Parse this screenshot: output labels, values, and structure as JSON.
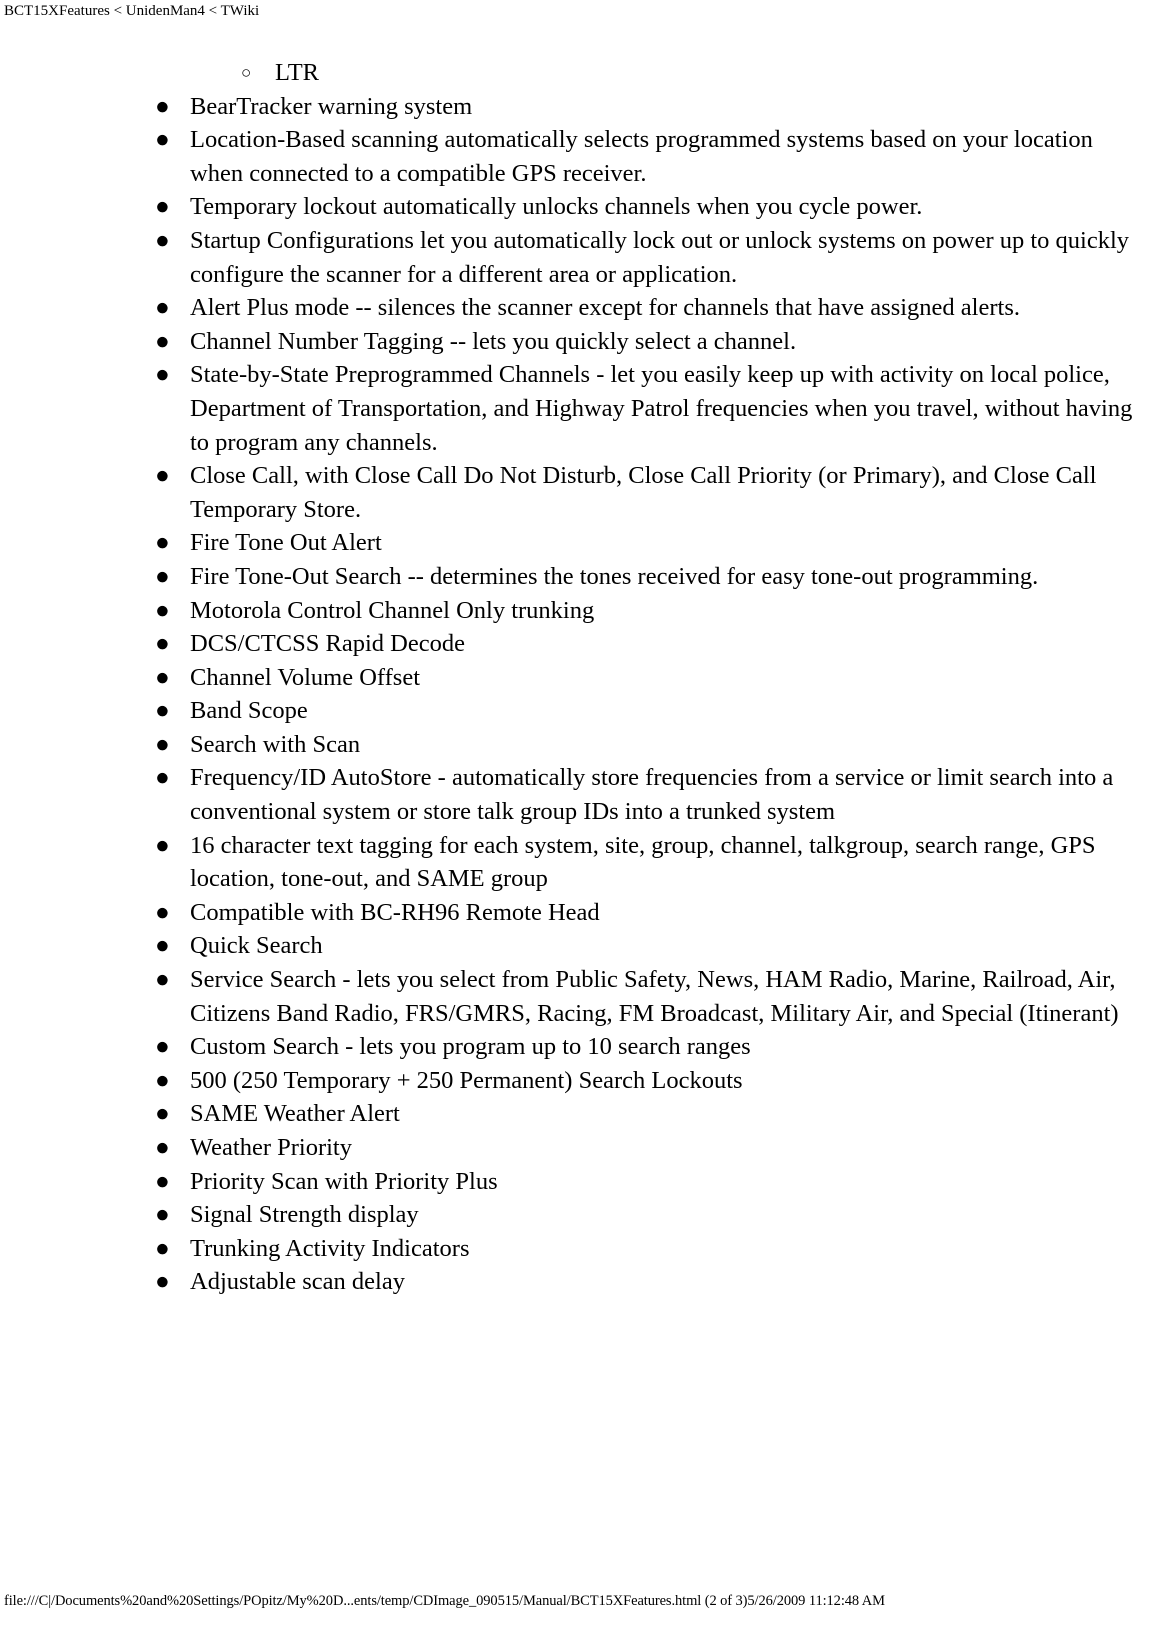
{
  "header": {
    "title": "BCT15XFeatures < UnidenMan4 < TWiki"
  },
  "bullets": {
    "disc": "●",
    "circle": "○"
  },
  "list": {
    "items": [
      {
        "level": 2,
        "marker": "circle",
        "text": "LTR"
      },
      {
        "level": 1,
        "marker": "disc",
        "text": "BearTracker warning system"
      },
      {
        "level": 1,
        "marker": "disc",
        "text": "Location-Based scanning automatically selects programmed systems based on your location when connected to a compatible GPS receiver."
      },
      {
        "level": 1,
        "marker": "disc",
        "text": "Temporary lockout automatically unlocks channels when you cycle power."
      },
      {
        "level": 1,
        "marker": "disc",
        "text": "Startup Configurations let you automatically lock out or unlock systems on power up to quickly configure the scanner for a different area or application."
      },
      {
        "level": 1,
        "marker": "disc",
        "text": "Alert Plus mode -- silences the scanner except for channels that have assigned alerts."
      },
      {
        "level": 1,
        "marker": "disc",
        "text": "Channel Number Tagging -- lets you quickly select a channel."
      },
      {
        "level": 1,
        "marker": "disc",
        "text": "State-by-State Preprogrammed Channels - let you easily keep up with activity on local police, Department of Transportation, and Highway Patrol frequencies when you travel, without having to program any channels."
      },
      {
        "level": 1,
        "marker": "disc",
        "text": "Close Call, with Close Call Do Not Disturb, Close Call Priority (or Primary), and Close Call Temporary Store."
      },
      {
        "level": 1,
        "marker": "disc",
        "text": "Fire Tone Out Alert"
      },
      {
        "level": 1,
        "marker": "disc",
        "text": "Fire Tone-Out Search -- determines the tones received for easy tone-out programming."
      },
      {
        "level": 1,
        "marker": "disc",
        "text": "Motorola Control Channel Only trunking"
      },
      {
        "level": 1,
        "marker": "disc",
        "text": "DCS/CTCSS Rapid Decode"
      },
      {
        "level": 1,
        "marker": "disc",
        "text": "Channel Volume Offset"
      },
      {
        "level": 1,
        "marker": "disc",
        "text": "Band Scope"
      },
      {
        "level": 1,
        "marker": "disc",
        "text": "Search with Scan"
      },
      {
        "level": 1,
        "marker": "disc",
        "text": "Frequency/ID AutoStore - automatically store frequencies from a service or limit search into a conventional system or store talk group IDs into a trunked system"
      },
      {
        "level": 1,
        "marker": "disc",
        "text": "16 character text tagging for each system, site, group, channel, talkgroup, search range, GPS location, tone-out, and SAME group"
      },
      {
        "level": 1,
        "marker": "disc",
        "text": "Compatible with BC-RH96 Remote Head"
      },
      {
        "level": 1,
        "marker": "disc",
        "text": "Quick Search"
      },
      {
        "level": 1,
        "marker": "disc",
        "text": "Service Search - lets you select from Public Safety, News, HAM Radio, Marine, Railroad, Air, Citizens Band Radio, FRS/GMRS, Racing, FM Broadcast, Military Air, and Special (Itinerant)"
      },
      {
        "level": 1,
        "marker": "disc",
        "text": "Custom Search - lets you program up to 10 search ranges"
      },
      {
        "level": 1,
        "marker": "disc",
        "text": "500 (250 Temporary + 250 Permanent) Search Lockouts"
      },
      {
        "level": 1,
        "marker": "disc",
        "text": "SAME Weather Alert"
      },
      {
        "level": 1,
        "marker": "disc",
        "text": "Weather Priority"
      },
      {
        "level": 1,
        "marker": "disc",
        "text": "Priority Scan with Priority Plus"
      },
      {
        "level": 1,
        "marker": "disc",
        "text": "Signal Strength display"
      },
      {
        "level": 1,
        "marker": "disc",
        "text": "Trunking Activity Indicators"
      },
      {
        "level": 1,
        "marker": "disc",
        "text": "Adjustable scan delay"
      }
    ]
  },
  "footer": {
    "text": "file:///C|/Documents%20and%20Settings/POpitz/My%20D...ents/temp/CDImage_090515/Manual/BCT15XFeatures.html (2 of 3)5/26/2009 11:12:48 AM"
  }
}
